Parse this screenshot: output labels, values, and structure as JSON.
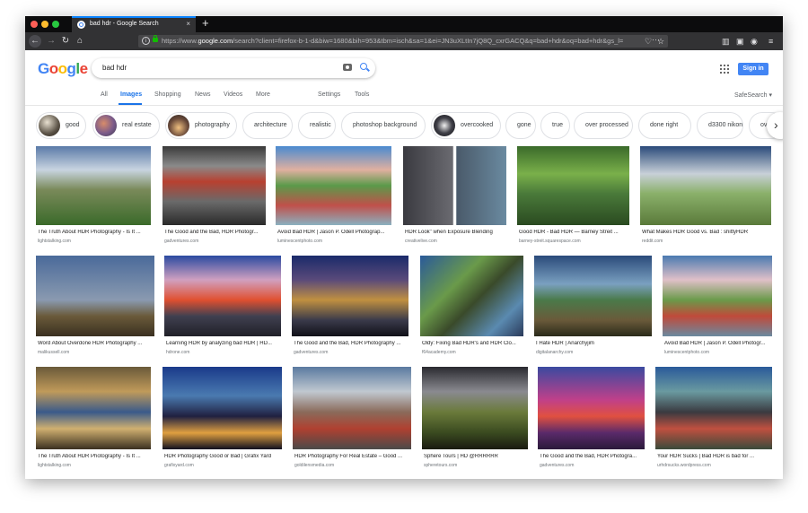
{
  "browser": {
    "tab_title": "bad hdr - Google Search",
    "tab_close": "×",
    "new_tab": "+",
    "url_prefix": "https://www.",
    "url_domain": "google.com",
    "url_rest": "/search?client=firefox-b-1-d&biw=1680&bih=953&tbm=isch&sa=1&ei=JN3uXLtIn7jQ8Q_cxrGACQ&q=bad+hdr&oq=bad+hdr&gs_l=",
    "url_more": "···",
    "colors": {
      "close": "#ff5f57",
      "minimize": "#febc2e",
      "maximize": "#28c840"
    }
  },
  "header": {
    "logo": [
      "G",
      "o",
      "o",
      "g",
      "l",
      "e"
    ],
    "logo_colors": [
      "#4285f4",
      "#ea4335",
      "#fbbc05",
      "#4285f4",
      "#34a853",
      "#ea4335"
    ],
    "query": "bad hdr",
    "signin": "Sign in"
  },
  "nav": {
    "all": "All",
    "images": "Images",
    "shopping": "Shopping",
    "news": "News",
    "videos": "Videos",
    "more": "More",
    "settings": "Settings",
    "tools": "Tools",
    "safesearch": "SafeSearch ▾"
  },
  "chips": [
    {
      "label": "good",
      "thumb": true
    },
    {
      "label": "real estate",
      "thumb": true
    },
    {
      "label": "photography",
      "thumb": true
    },
    {
      "label": "architecture",
      "thumb": false
    },
    {
      "label": "realistic",
      "thumb": false
    },
    {
      "label": "photoshop background",
      "thumb": false
    },
    {
      "label": "overcooked",
      "thumb": true
    },
    {
      "label": "gone",
      "thumb": false
    },
    {
      "label": "true",
      "thumb": false
    },
    {
      "label": "over processed",
      "thumb": false
    },
    {
      "label": "done right",
      "thumb": false
    },
    {
      "label": "d3300 nikon",
      "thumb": false
    },
    {
      "label": "ove",
      "thumb": false
    }
  ],
  "chip_next": "›",
  "results": [
    [
      {
        "caption": "The Truth About HDR Photography - Is It ...",
        "source": "lightstalking.com"
      },
      {
        "caption": "The Good and the Bad, HDR Photogr...",
        "source": "gadventures.com"
      },
      {
        "caption": "Avoid Bad HDR | Jason P. Odell Photograp...",
        "source": "luminescentphoto.com"
      },
      {
        "caption": "HDR Look\" when Exposure Blending",
        "source": "creativelive.com"
      },
      {
        "caption": "Good HDR - Bad HDR — Barney Streit ...",
        "source": "barney-streit.squarespace.com"
      },
      {
        "caption": "What Makes HDR Good vs. Bad : shittyHDR",
        "source": "reddit.com"
      }
    ],
    [
      {
        "caption": "Word About Overdone HDR Photography ...",
        "source": "malikussell.com"
      },
      {
        "caption": "Learning HDR by analyzing bad HDR | HD...",
        "source": "hdrone.com"
      },
      {
        "caption": "The Good and the Bad, HDR Photography ...",
        "source": "gadventures.com"
      },
      {
        "caption": "Oldy: Fixing Bad HDR's and HDR Clo...",
        "source": "f64academy.com"
      },
      {
        "caption": "I Hate HDR | Anarchyjim",
        "source": "digitalanarchy.com"
      },
      {
        "caption": "Avoid Bad HDR | Jason P. Odell Photogr...",
        "source": "luminescentphoto.com"
      }
    ],
    [
      {
        "caption": "The Truth About HDR Photography - Is It ...",
        "source": "lightstalking.com"
      },
      {
        "caption": "HDR Photography Good or Bad | Grafix Yard",
        "source": "grafixyard.com"
      },
      {
        "caption": "HDR Photography For Real Estate – Good ...",
        "source": "goldilensmedia.com"
      },
      {
        "caption": "Sphere Tours | HD @RRRRRR",
        "source": "spheretours.com"
      },
      {
        "caption": "The Good and the Bad, HDR Photogra...",
        "source": "gadventures.com"
      },
      {
        "caption": "Your HDR Sucks | Bad HDR is bad for ...",
        "source": "urhdrsucks.wordpress.com"
      }
    ]
  ]
}
